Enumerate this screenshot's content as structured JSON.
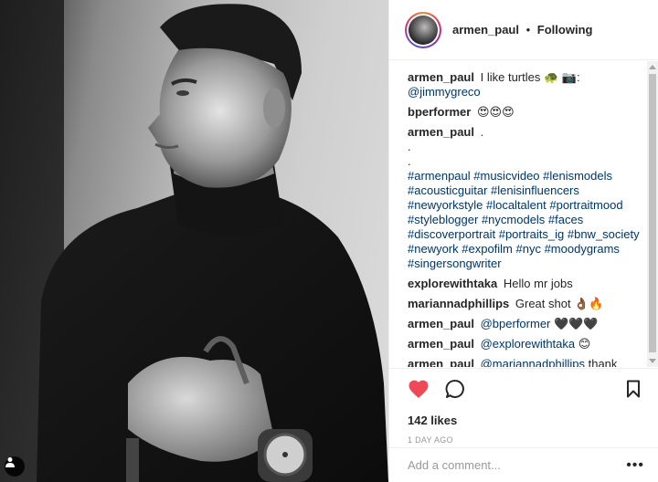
{
  "header": {
    "username": "armen_paul",
    "separator": "•",
    "follow_status": "Following"
  },
  "comments": [
    {
      "user": "armen_paul",
      "text": "I like turtles 🐢 📷:",
      "mention": "@jimmygreco"
    },
    {
      "user": "bperformer",
      "text": "😍😍😍"
    },
    {
      "user": "armen_paul",
      "text": ".",
      "lines": [
        ".",
        "."
      ],
      "hashtags": "#armenpaul #musicvideo #lenismodels #acousticguitar #lenisinfluencers #newyorkstyle #localtalent #portraitmood #styleblogger #nycmodels #faces #discoverportrait #portraits_ig #bnw_society #newyork #expofilm #nyc #moodygrams #singersongwriter"
    },
    {
      "user": "explorewithtaka",
      "text": "Hello mr jobs"
    },
    {
      "user": "mariannadphillips",
      "text": "Great shot 👌🏾🔥"
    },
    {
      "user": "armen_paul",
      "mention": "@bperformer",
      "text": "🖤🖤🖤"
    },
    {
      "user": "armen_paul",
      "mention": "@explorewithtaka",
      "text": "😊"
    },
    {
      "user": "armen_paul",
      "mention": "@mariannadphillips",
      "text": "thank"
    }
  ],
  "actions": {
    "like_icon": "heart-filled-icon",
    "comment_icon": "comment-bubble-icon",
    "save_icon": "bookmark-icon",
    "like_color": "#ed4956"
  },
  "likes": "142 likes",
  "time_ago": "1 DAY AGO",
  "add_comment": {
    "placeholder": "Add a comment...",
    "more_label": "•••"
  }
}
